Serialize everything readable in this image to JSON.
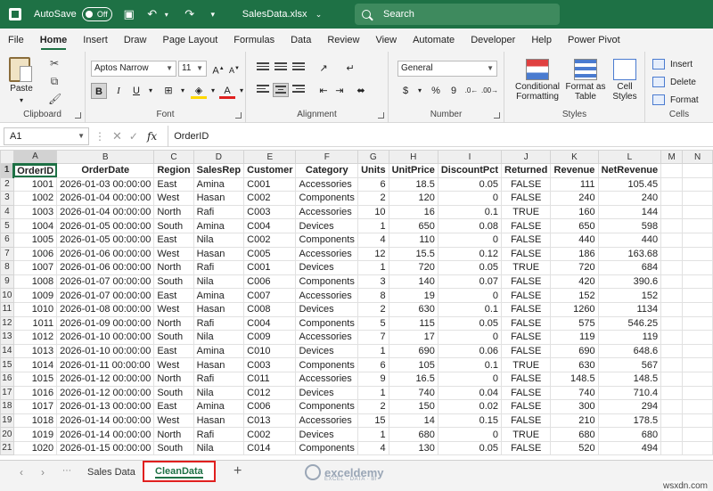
{
  "titlebar": {
    "autosave_label": "AutoSave",
    "autosave_state": "Off",
    "filename": "SalesData.xlsx",
    "search_placeholder": "Search"
  },
  "menu": [
    "File",
    "Home",
    "Insert",
    "Draw",
    "Page Layout",
    "Formulas",
    "Data",
    "Review",
    "View",
    "Automate",
    "Developer",
    "Help",
    "Power Pivot"
  ],
  "active_menu": "Home",
  "ribbon": {
    "clipboard": {
      "label": "Clipboard",
      "paste": "Paste"
    },
    "font": {
      "label": "Font",
      "name": "Aptos Narrow",
      "size": "11",
      "bold": "B",
      "italic": "I",
      "underline": "U"
    },
    "alignment": {
      "label": "Alignment"
    },
    "number": {
      "label": "Number",
      "format": "General",
      "currency": "$",
      "percent": "%",
      "comma": "9"
    },
    "styles": {
      "label": "Styles",
      "cond_fmt": "Conditional",
      "cond_fmt2": "Formatting",
      "fmt_table": "Format as",
      "fmt_table2": "Table",
      "cell_styles": "Cell",
      "cell_styles2": "Styles"
    },
    "cells": {
      "label": "Cells",
      "insert": "Insert",
      "delete": "Delete",
      "format": "Format"
    }
  },
  "formula_bar": {
    "name_box": "A1",
    "fx": "fx",
    "content": "OrderID"
  },
  "grid": {
    "columns": [
      "A",
      "B",
      "C",
      "D",
      "E",
      "F",
      "G",
      "H",
      "I",
      "J",
      "K",
      "L",
      "M",
      "N"
    ],
    "headers": [
      "OrderID",
      "OrderDate",
      "Region",
      "SalesRep",
      "Customer",
      "Category",
      "Units",
      "UnitPrice",
      "DiscountPct",
      "Returned",
      "Revenue",
      "NetRevenue"
    ],
    "rows": [
      [
        "1001",
        "2026-01-03 00:00:00",
        "East",
        "Amina",
        "C001",
        "Accessories",
        "6",
        "18.5",
        "0.05",
        "FALSE",
        "111",
        "105.45"
      ],
      [
        "1002",
        "2026-01-04 00:00:00",
        "West",
        "Hasan",
        "C002",
        "Components",
        "2",
        "120",
        "0",
        "FALSE",
        "240",
        "240"
      ],
      [
        "1003",
        "2026-01-04 00:00:00",
        "North",
        "Rafi",
        "C003",
        "Accessories",
        "10",
        "16",
        "0.1",
        "TRUE",
        "160",
        "144"
      ],
      [
        "1004",
        "2026-01-05 00:00:00",
        "South",
        "Amina",
        "C004",
        "Devices",
        "1",
        "650",
        "0.08",
        "FALSE",
        "650",
        "598"
      ],
      [
        "1005",
        "2026-01-05 00:00:00",
        "East",
        "Nila",
        "C002",
        "Components",
        "4",
        "110",
        "0",
        "FALSE",
        "440",
        "440"
      ],
      [
        "1006",
        "2026-01-06 00:00:00",
        "West",
        "Hasan",
        "C005",
        "Accessories",
        "12",
        "15.5",
        "0.12",
        "FALSE",
        "186",
        "163.68"
      ],
      [
        "1007",
        "2026-01-06 00:00:00",
        "North",
        "Rafi",
        "C001",
        "Devices",
        "1",
        "720",
        "0.05",
        "TRUE",
        "720",
        "684"
      ],
      [
        "1008",
        "2026-01-07 00:00:00",
        "South",
        "Nila",
        "C006",
        "Components",
        "3",
        "140",
        "0.07",
        "FALSE",
        "420",
        "390.6"
      ],
      [
        "1009",
        "2026-01-07 00:00:00",
        "East",
        "Amina",
        "C007",
        "Accessories",
        "8",
        "19",
        "0",
        "FALSE",
        "152",
        "152"
      ],
      [
        "1010",
        "2026-01-08 00:00:00",
        "West",
        "Hasan",
        "C008",
        "Devices",
        "2",
        "630",
        "0.1",
        "FALSE",
        "1260",
        "1134"
      ],
      [
        "1011",
        "2026-01-09 00:00:00",
        "North",
        "Rafi",
        "C004",
        "Components",
        "5",
        "115",
        "0.05",
        "FALSE",
        "575",
        "546.25"
      ],
      [
        "1012",
        "2026-01-10 00:00:00",
        "South",
        "Nila",
        "C009",
        "Accessories",
        "7",
        "17",
        "0",
        "FALSE",
        "119",
        "119"
      ],
      [
        "1013",
        "2026-01-10 00:00:00",
        "East",
        "Amina",
        "C010",
        "Devices",
        "1",
        "690",
        "0.06",
        "FALSE",
        "690",
        "648.6"
      ],
      [
        "1014",
        "2026-01-11 00:00:00",
        "West",
        "Hasan",
        "C003",
        "Components",
        "6",
        "105",
        "0.1",
        "TRUE",
        "630",
        "567"
      ],
      [
        "1015",
        "2026-01-12 00:00:00",
        "North",
        "Rafi",
        "C011",
        "Accessories",
        "9",
        "16.5",
        "0",
        "FALSE",
        "148.5",
        "148.5"
      ],
      [
        "1016",
        "2026-01-12 00:00:00",
        "South",
        "Nila",
        "C012",
        "Devices",
        "1",
        "740",
        "0.04",
        "FALSE",
        "740",
        "710.4"
      ],
      [
        "1017",
        "2026-01-13 00:00:00",
        "East",
        "Amina",
        "C006",
        "Components",
        "2",
        "150",
        "0.02",
        "FALSE",
        "300",
        "294"
      ],
      [
        "1018",
        "2026-01-14 00:00:00",
        "West",
        "Hasan",
        "C013",
        "Accessories",
        "15",
        "14",
        "0.15",
        "FALSE",
        "210",
        "178.5"
      ],
      [
        "1019",
        "2026-01-14 00:00:00",
        "North",
        "Rafi",
        "C002",
        "Devices",
        "1",
        "680",
        "0",
        "TRUE",
        "680",
        "680"
      ],
      [
        "1020",
        "2026-01-15 00:00:00",
        "South",
        "Nila",
        "C014",
        "Components",
        "4",
        "130",
        "0.05",
        "FALSE",
        "520",
        "494"
      ]
    ]
  },
  "sheets": [
    "Sales Data",
    "CleanData"
  ],
  "active_sheet": "CleanData",
  "watermark": {
    "name": "exceldemy",
    "tagline": "EXCEL · DATA · BI"
  },
  "corner_watermark": "wsxdn.com",
  "colors": {
    "excel_green": "#1e7145",
    "highlight_red": "#e0201f"
  }
}
